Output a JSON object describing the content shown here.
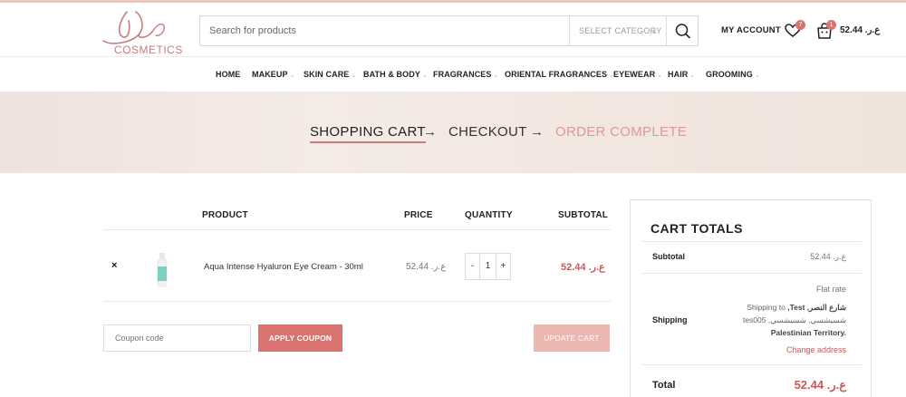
{
  "header": {
    "logo_text": "COSMETICS",
    "search_placeholder": "Search for products",
    "category_label": "SELECT CATEGORY",
    "my_account": "MY ACCOUNT",
    "wishlist_count": "7",
    "cart_count": "1",
    "cart_amount": "52.44 .ع.ر"
  },
  "nav": {
    "items": [
      {
        "label": "HOME"
      },
      {
        "label": "MAKEUP"
      },
      {
        "label": "SKIN CARE"
      },
      {
        "label": "BATH & BODY"
      },
      {
        "label": "FRAGRANCES"
      },
      {
        "label": "ORIENTAL FRAGRANCES"
      },
      {
        "label": "EYEWEAR"
      },
      {
        "label": "HAIR"
      },
      {
        "label": "GROOMING"
      }
    ]
  },
  "steps": {
    "cart": "SHOPPING CART",
    "checkout": "CHECKOUT",
    "complete": "ORDER COMPLETE",
    "arrow": "→"
  },
  "table": {
    "headers": {
      "product": "PRODUCT",
      "price": "PRICE",
      "quantity": "QUANTITY",
      "subtotal": "SUBTOTAL"
    },
    "rows": [
      {
        "name": "Aqua Intense Hyaluron Eye Cream - 30ml",
        "price": "52.44 .ع.ر",
        "qty": "1",
        "subtotal": "52.44 .ع.ر"
      }
    ],
    "remove": "×",
    "minus": "-",
    "plus": "+"
  },
  "actions": {
    "coupon_placeholder": "Coupon code",
    "apply_coupon": "APPLY COUPON",
    "update_cart": "UPDATE CART"
  },
  "totals": {
    "title": "CART TOTALS",
    "subtotal_label": "Subtotal",
    "subtotal_value": "52.44 .ع.ر",
    "shipping_label": "Shipping",
    "shipping_method": "Flat rate",
    "shipping_to_prefix": "Shipping to",
    "shipping_address_line1": "شارع النصر, Test,",
    "shipping_address_line2": "شسيشسي, شسيشسي,",
    "shipping_address_line3": "tes005",
    "shipping_address_line4": "Palestinian Territory.",
    "change_address": "Change address",
    "total_label": "Total",
    "total_value": "52.44 .ع.ر"
  },
  "colors": {
    "accent": "#d9736f",
    "price_red": "#c45a5a",
    "banner_bg": "#f3e7e1"
  }
}
